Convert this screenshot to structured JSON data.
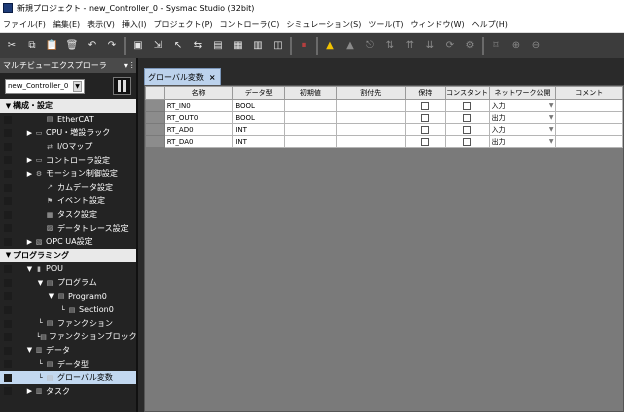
{
  "window": {
    "title": "新規プロジェクト - new_Controller_0 - Sysmac Studio (32bit)"
  },
  "menu": [
    "ファイル(F)",
    "編集(E)",
    "表示(V)",
    "挿入(I)",
    "プロジェクト(P)",
    "コントローラ(C)",
    "シミュレーション(S)",
    "ツール(T)",
    "ウィンドウ(W)",
    "ヘルプ(H)"
  ],
  "toolbar": {
    "icons": [
      "cut-icon",
      "copy-icon",
      "paste-icon",
      "delete-icon",
      "undo-icon",
      "redo-icon",
      "print-icon",
      "build-icon",
      "cross-reference-icon",
      "compare-icon",
      "watch-icon",
      "search-icon",
      "find-replace-icon",
      "output-icon",
      "online-icon",
      "warning-icon",
      "alarm-icon",
      "tag-icon",
      "transfer-icon",
      "upload-icon",
      "download-icon",
      "refresh-icon",
      "settings-icon",
      "zoom-icon",
      "zoom-in-icon",
      "zoom-out-icon"
    ]
  },
  "explorer": {
    "title": "マルチビューエクスプローラ",
    "pin_glyphs": "▾ ⵗ",
    "controller": "new_Controller_0",
    "items": [
      {
        "label": "構成・設定",
        "level": 0,
        "expanded": true,
        "group": true,
        "icon": ""
      },
      {
        "label": "EtherCAT",
        "level": 2,
        "icon": "▤"
      },
      {
        "label": "CPU・増設ラック",
        "level": 1,
        "collapsed": true,
        "icon": "▭"
      },
      {
        "label": "I/Oマップ",
        "level": 2,
        "icon": "⇄"
      },
      {
        "label": "コントローラ設定",
        "level": 1,
        "collapsed": true,
        "icon": "▭"
      },
      {
        "label": "モーション制御設定",
        "level": 1,
        "collapsed": true,
        "icon": "⚙"
      },
      {
        "label": "カムデータ設定",
        "level": 2,
        "icon": "↗"
      },
      {
        "label": "イベント設定",
        "level": 2,
        "icon": "⚑"
      },
      {
        "label": "タスク設定",
        "level": 2,
        "icon": "▦"
      },
      {
        "label": "データトレース設定",
        "level": 2,
        "icon": "▨"
      },
      {
        "label": "OPC UA設定",
        "level": 1,
        "collapsed": true,
        "icon": "▧"
      },
      {
        "label": "プログラミング",
        "level": 0,
        "expanded": true,
        "group": true,
        "icon": ""
      },
      {
        "label": "POU",
        "level": 1,
        "expanded": true,
        "icon": "▮"
      },
      {
        "label": "プログラム",
        "level": 2,
        "expanded": true,
        "icon": "▤"
      },
      {
        "label": "Program0",
        "level": 3,
        "expanded": true,
        "icon": "▤"
      },
      {
        "label": "Section0",
        "level": 4,
        "icon": "▤",
        "leaf": true
      },
      {
        "label": "ファンクション",
        "level": 2,
        "icon": "▤",
        "leaf": true
      },
      {
        "label": "ファンクションブロック",
        "level": 2,
        "icon": "▤",
        "leaf": true
      },
      {
        "label": "データ",
        "level": 1,
        "expanded": true,
        "icon": "▥"
      },
      {
        "label": "データ型",
        "level": 2,
        "icon": "▤",
        "leaf": true
      },
      {
        "label": "グローバル変数",
        "level": 2,
        "icon": "▤",
        "leaf": true,
        "selected": true
      },
      {
        "label": "タスク",
        "level": 1,
        "collapsed": true,
        "icon": "▥"
      }
    ]
  },
  "editor": {
    "tab_label": "グローバル変数",
    "close_glyph": "×",
    "columns": [
      "名称",
      "データ型",
      "初期値",
      "割付先",
      "保持",
      "コンスタント",
      "ネットワーク公開",
      "コメント"
    ],
    "rows": [
      {
        "name": "RT_IN0",
        "type": "BOOL",
        "init": "",
        "at": "",
        "retain": false,
        "constant": false,
        "publish": "入力",
        "comment": ""
      },
      {
        "name": "RT_OUT0",
        "type": "BOOL",
        "init": "",
        "at": "",
        "retain": false,
        "constant": false,
        "publish": "出力",
        "comment": ""
      },
      {
        "name": "RT_AD0",
        "type": "INT",
        "init": "",
        "at": "",
        "retain": false,
        "constant": false,
        "publish": "入力",
        "comment": ""
      },
      {
        "name": "RT_DA0",
        "type": "INT",
        "init": "",
        "at": "",
        "retain": false,
        "constant": false,
        "publish": "出力",
        "comment": ""
      }
    ]
  }
}
